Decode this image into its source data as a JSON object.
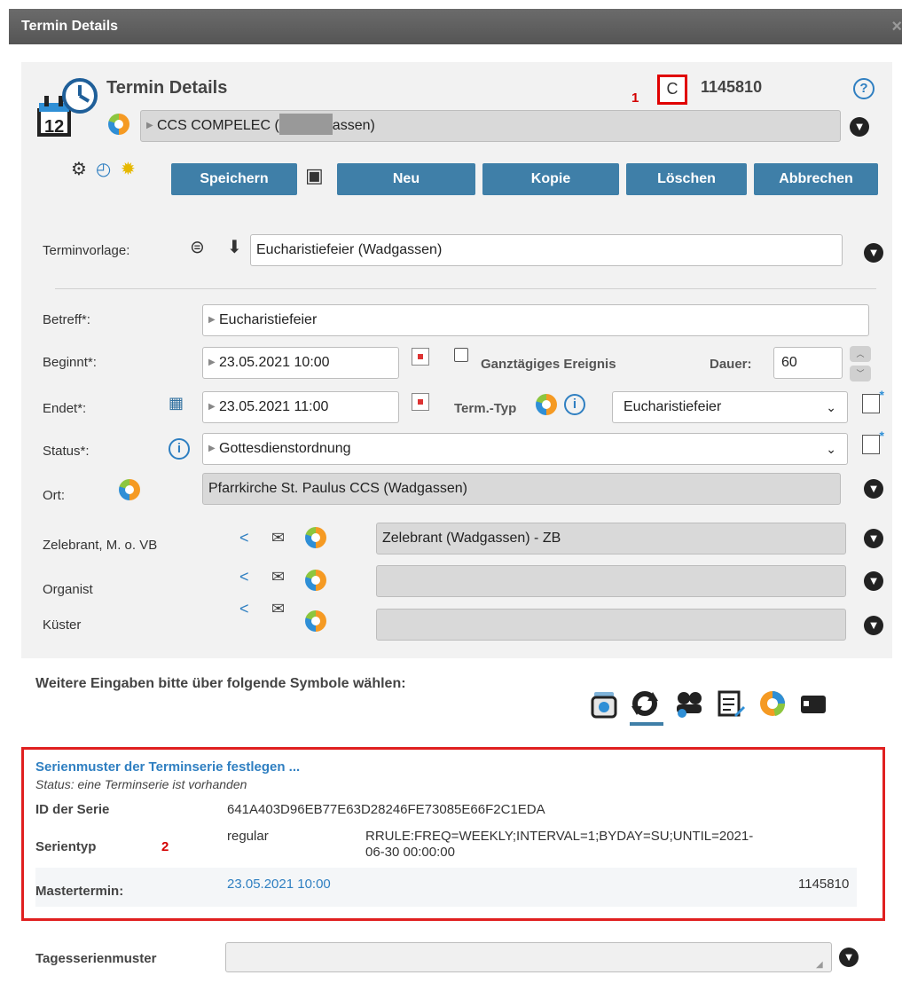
{
  "window": {
    "title": "Termin Details",
    "close_glyph": "×"
  },
  "header": {
    "title": "Termin Details",
    "marker_1": "1",
    "refresh_glyph": "C",
    "term_id": "1145810",
    "help_glyph": "?",
    "organisation_prefix": "CCS COMPELEC (",
    "organisation_suffix": "assen)"
  },
  "toolbar": {
    "save_label": "Speichern",
    "new_label": "Neu",
    "copy_label": "Kopie",
    "delete_label": "Löschen",
    "cancel_label": "Abbrechen"
  },
  "form": {
    "template_label": "Terminvorlage:",
    "template_value": "Eucharistiefeier (Wadgassen)",
    "subject_label": "Betreff*:",
    "subject_value": "Eucharistiefeier",
    "begin_label": "Beginnt*:",
    "begin_value": "23.05.2021 10:00",
    "allday_label": "Ganztägiges Ereignis",
    "duration_label": "Dauer:",
    "duration_value": "60",
    "end_label": "Endet*:",
    "end_value": "23.05.2021 11:00",
    "type_label": "Term.-Typ",
    "type_value": "Eucharistiefeier",
    "status_label": "Status*:",
    "status_value": "Gottesdienstordnung",
    "location_label": "Ort:",
    "location_value": "Pfarrkirche St. Paulus CCS (Wadgassen)",
    "celebrant_label": "Zelebrant, M. o. VB",
    "celebrant_value": "Zelebrant (Wadgassen) - ZB",
    "organist_label": "Organist",
    "organist_value": "",
    "sexton_label": "Küster",
    "sexton_value": ""
  },
  "more": {
    "prompt": "Weitere Eingaben bitte über folgende Symbole wählen:"
  },
  "series": {
    "title": "Serienmuster der Terminserie festlegen ...",
    "status": "Status: eine Terminserie ist vorhanden",
    "id_label": "ID der Serie",
    "id_value": "641A403D96EB77E63D28246FE73085E66F2C1EDA",
    "type_label": "Serientyp",
    "marker_2": "2",
    "type_value": "regular",
    "rrule_line1": "RRULE:FREQ=WEEKLY;INTERVAL=1;BYDAY=SU;UNTIL=2021-",
    "rrule_line2": "06-30 00:00:00",
    "master_label": "Mastertermin:",
    "master_date": "23.05.2021 10:00",
    "master_id": "1145810"
  },
  "daily": {
    "label": "Tagesserienmuster"
  }
}
